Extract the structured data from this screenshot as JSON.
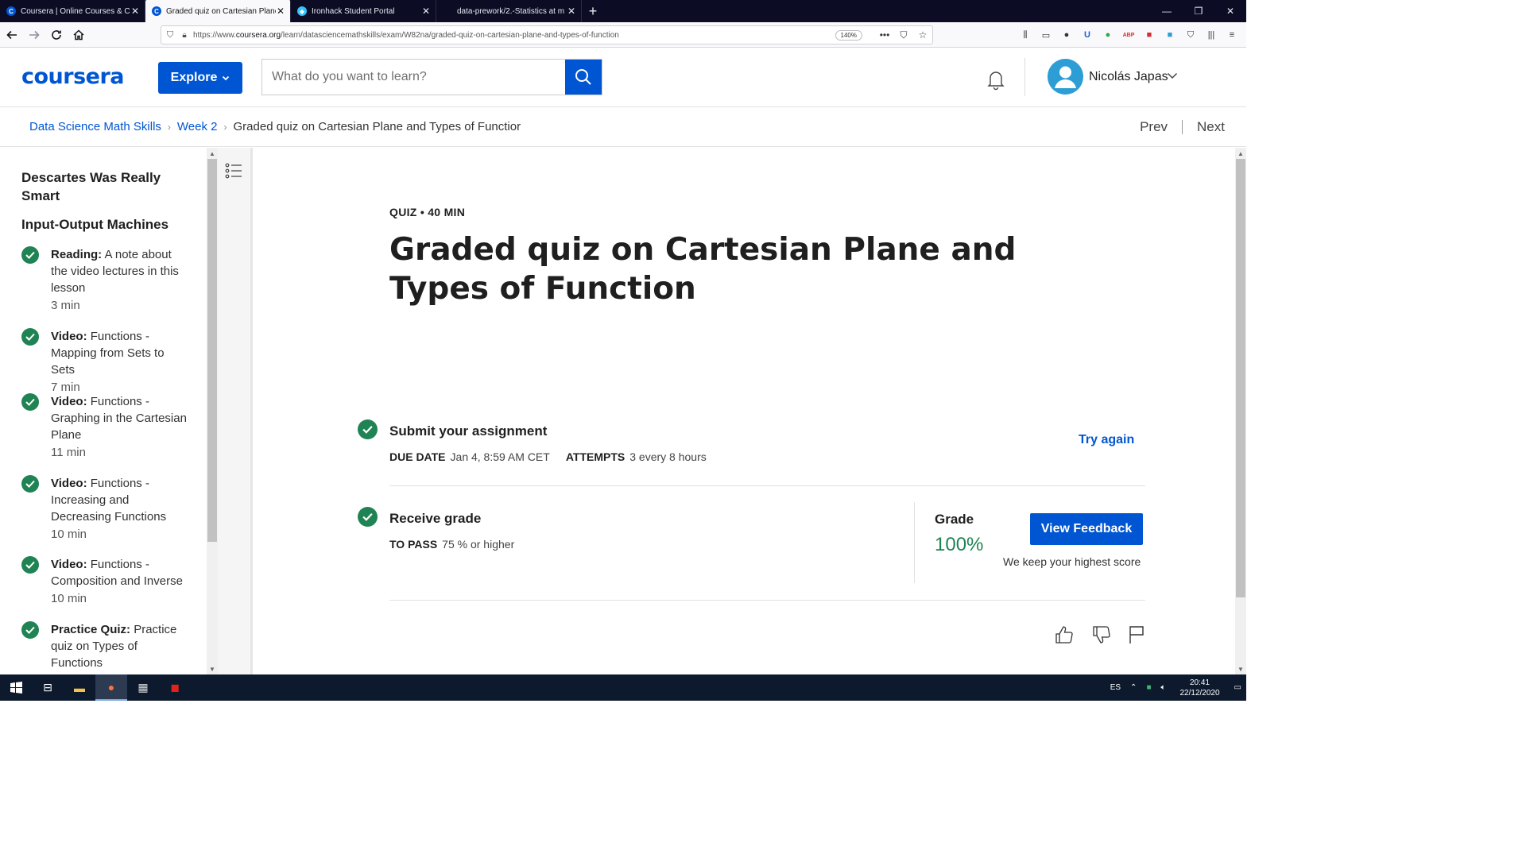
{
  "browser": {
    "tabs": [
      {
        "title": "Coursera | Online Courses & Cr",
        "favicon": "coursera-favicon",
        "active": false
      },
      {
        "title": "Graded quiz on Cartesian Plane",
        "favicon": "coursera-favicon",
        "active": true
      },
      {
        "title": "Ironhack Student Portal",
        "favicon": "ironhack-favicon",
        "active": false
      },
      {
        "title": "data-prework/2.-Statistics at m",
        "favicon": "github-favicon",
        "active": false
      }
    ],
    "url_prefix": "https://www.",
    "url_domain": "coursera.org",
    "url_path": "/learn/datasciencemathskills/exam/W82na/graded-quiz-on-cartesian-plane-and-types-of-function",
    "zoom": "140%"
  },
  "header": {
    "logo": "coursera",
    "explore_label": "Explore",
    "search_placeholder": "What do you want to learn?",
    "user_name": "Nicolás Japas"
  },
  "breadcrumb": {
    "items": [
      "Data Science Math Skills",
      "Week 2"
    ],
    "current": "Graded quiz on Cartesian Plane and Types of Functior",
    "prev": "Prev",
    "next": "Next"
  },
  "sidebar": {
    "section_partial": "Descartes Was Really Smart",
    "section_title": "Input-Output Machines",
    "items": [
      {
        "type": "Reading:",
        "title": "A note about the video lectures in this lesson",
        "duration": "3 min"
      },
      {
        "type": "Video:",
        "title": "Functions - Mapping from Sets to Sets",
        "duration": "7 min"
      },
      {
        "type": "Video:",
        "title": "Functions - Graphing in the Cartesian Plane",
        "duration": "11 min"
      },
      {
        "type": "Video:",
        "title": "Functions - Increasing and Decreasing Functions",
        "duration": "10 min"
      },
      {
        "type": "Video:",
        "title": "Functions - Composition and Inverse",
        "duration": "10 min"
      },
      {
        "type": "Practice Quiz:",
        "title": "Practice quiz on Types of Functions",
        "duration": ""
      }
    ]
  },
  "quiz": {
    "meta": "QUIZ • 40 MIN",
    "title": "Graded quiz on Cartesian Plane and Types of Function",
    "submit": {
      "title": "Submit your assignment",
      "due_label": "DUE DATE",
      "due_value": "Jan 4, 8:59 AM CET",
      "attempts_label": "ATTEMPTS",
      "attempts_value": "3 every 8 hours",
      "action": "Try again"
    },
    "grade": {
      "title": "Receive grade",
      "pass_label": "TO PASS",
      "pass_value": "75 % or higher",
      "grade_label": "Grade",
      "grade_value": "100%",
      "button": "View Feedback",
      "note": "We keep your highest score"
    }
  },
  "taskbar": {
    "lang": "ES",
    "time": "20:41",
    "date": "22/12/2020"
  },
  "colors": {
    "brand": "#0056d2",
    "success": "#1f8354"
  }
}
